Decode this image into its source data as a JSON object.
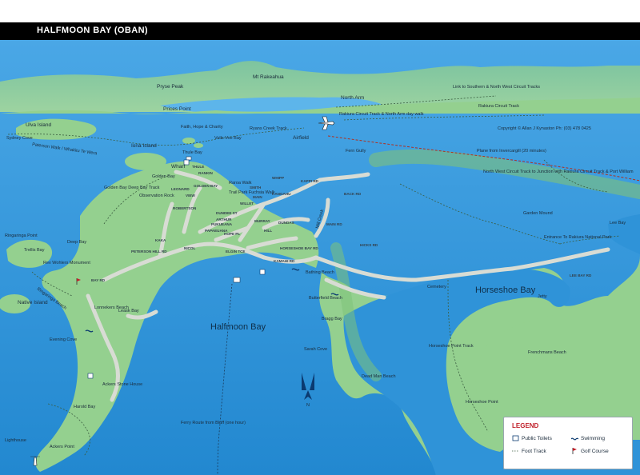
{
  "title": "HALFMOON BAY (OBAN)",
  "copyright": "Copyright © Allan J Kynaston  Ph: (03) 478 0425",
  "colors": {
    "sea": "#2a8fd6",
    "land": "#8fcf8a",
    "land_dark": "#6db66f",
    "title_bar": "#000000",
    "legend_title": "#c0202a"
  },
  "water_labels": {
    "halfmoon_bay": "Halfmoon Bay",
    "horseshoe_bay": "Horseshoe Bay"
  },
  "place_labels": [
    "Pryse Peak",
    "Mt Rakeahua",
    "Prices Point",
    "North Arm",
    "Ulva Island",
    "Sydney Cove",
    "Iona Island",
    "Faith, Hope & Charity",
    "Volls Voe Bay",
    "Ryans Creek Track",
    "Airfield",
    "Fern Gully",
    "Thule Bay",
    "Wharf",
    "Golden Bay",
    "Golden Bay Deep Bay Track",
    "Observation Rock",
    "Raroa Walk",
    "Trail Park Fuchsia Walk",
    "Mill Creek",
    "Ringaringa Point",
    "Deep Bay",
    "Trellis Bay",
    "Rev Wohlers Monument",
    "Native Island",
    "Lonnekers Beach",
    "Bathing Beach",
    "Butterfield Beach",
    "Bragg Bay",
    "Sarah Cove",
    "Leask Bay",
    "Evening Cove",
    "Ackers Stone House",
    "Harold Bay",
    "Lighthouse",
    "Ackers Point",
    "Dead Man Beach",
    "Cemetery",
    "Jetty",
    "Horseshoe Point Track",
    "Horseshoe Point",
    "Frenchmans Beach",
    "Lee Bay",
    "Garden Mound",
    "Entrance To Rakiura National Park",
    "North West Circuit Track to Junction with Rakiura Circuit Track & Port William",
    "Link to Southern & North West Circuit Tracks",
    "Rakiura Circuit Track",
    "Rakiura Circuit Track & North Arm day walk",
    "Ringaringa Beach",
    "Paterson Walk / Whakitu Te Wera"
  ],
  "routes": {
    "plane": "Plane from Invercargill (20 minutes)",
    "ferry": "Ferry Route from Bluff (one hour)"
  },
  "roads": [
    "THULE",
    "RANKIN",
    "LEONARD",
    "VIEW",
    "GOLDEN BAY",
    "DUNDEE ST",
    "ARTHUR",
    "SMITH",
    "WHIPP",
    "MAIN",
    "WILLET",
    "KANGAHU",
    "KAKA",
    "PETERSON HILL RD",
    "NICOL",
    "ELGIN TCE",
    "MURRAY",
    "HILL",
    "DUNDAS",
    "HORSESHOE BAY RD",
    "KAMAHI RD",
    "ROBERTSON",
    "BAY RD",
    "HICKS RD",
    "BACK RD",
    "KAPPI RD",
    "MAIN RD",
    "LEE BAY RD",
    "PAPAEUANA",
    "PUKUEANA",
    "HOPE PL"
  ],
  "compass": "N",
  "legend": {
    "title": "LEGEND",
    "items": [
      {
        "label": "Public Toilets",
        "icon": "toilet-icon"
      },
      {
        "label": "Swimming",
        "icon": "swimming-icon"
      },
      {
        "label": "Foot Track",
        "icon": "foot-track-icon"
      },
      {
        "label": "Golf Course",
        "icon": "golf-flag-icon"
      }
    ]
  }
}
